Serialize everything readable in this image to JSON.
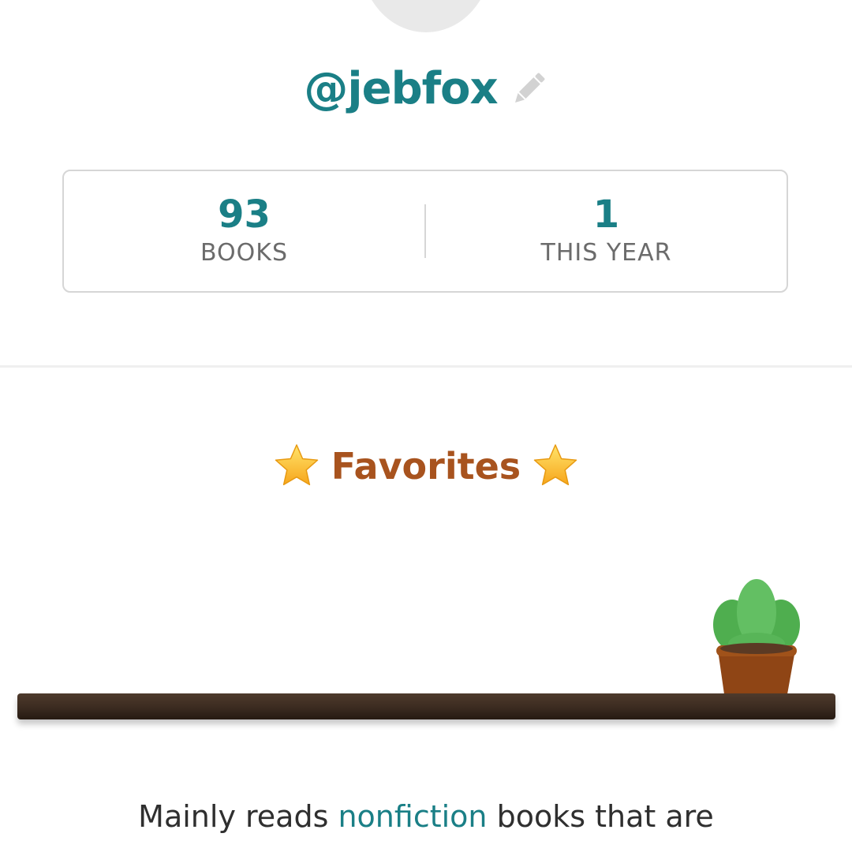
{
  "profile": {
    "username": "@jebfox",
    "edit_icon": "pencil-icon"
  },
  "stats": {
    "books": {
      "value": "93",
      "label": "BOOKS"
    },
    "this_year": {
      "value": "1",
      "label": "THIS YEAR"
    }
  },
  "favorites": {
    "title": "Favorites",
    "icon": "star-icon"
  },
  "shelf": {
    "decoration": "potted-plant-icon"
  },
  "bio": {
    "prefix": "Mainly reads ",
    "genre": "nonfiction",
    "suffix": " books that are"
  },
  "colors": {
    "accent": "#1a7f86",
    "favorites": "#a8531e",
    "shelf": "#3b2b20"
  }
}
